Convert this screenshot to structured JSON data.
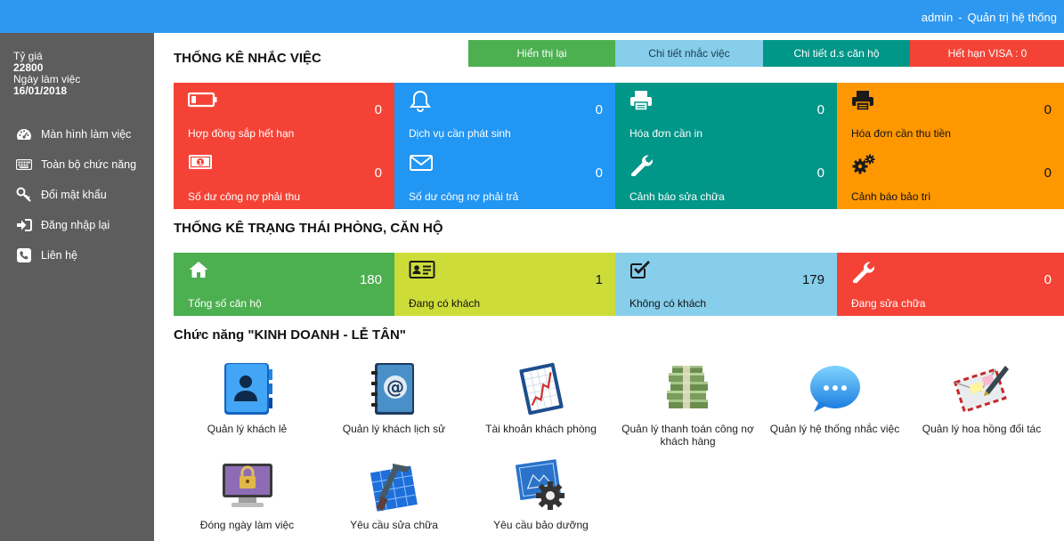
{
  "topbar": {
    "user": "admin",
    "separator": "-",
    "system": "Quản trị hệ thống"
  },
  "sidebar": {
    "rate_label": "Tỷ giá",
    "rate_value": "22800",
    "date_label": "Ngày làm việc",
    "date_value": "16/01/2018",
    "items": [
      {
        "label": "Màn hình làm việc",
        "icon": "dashboard-icon"
      },
      {
        "label": "Toàn bộ chức năng",
        "icon": "keyboard-icon"
      },
      {
        "label": "Đổi mật khẩu",
        "icon": "key-icon"
      },
      {
        "label": "Đăng nhập lại",
        "icon": "sign-in-icon"
      },
      {
        "label": "Liên hệ",
        "icon": "phone-icon"
      }
    ]
  },
  "reminders": {
    "title": "THỐNG KÊ NHẮC VIỆC",
    "actions": [
      {
        "label": "Hiển thị lại",
        "color": "#4caf50"
      },
      {
        "label": "Chi tiết nhắc việc",
        "color": "#87ceeb"
      },
      {
        "label": "Chi tiết d.s căn hộ",
        "color": "#009688"
      },
      {
        "label": "Hết hạn VISA : 0",
        "color": "#f44336"
      }
    ],
    "tiles": [
      {
        "label": "Hợp đồng sắp hết hạn",
        "value": "0",
        "color": "#f44336",
        "icon": "battery-icon"
      },
      {
        "label": "Dịch vụ cần phát sinh",
        "value": "0",
        "color": "#2196f3",
        "icon": "bell-icon"
      },
      {
        "label": "Hóa đơn cần in",
        "value": "0",
        "color": "#009688",
        "icon": "printer-icon"
      },
      {
        "label": "Hóa đơn cần thu tiền",
        "value": "0",
        "color": "#ff9800",
        "icon": "printer-icon"
      },
      {
        "label": "Số dư công nợ phải thu",
        "value": "0",
        "color": "#f44336",
        "icon": "money-icon"
      },
      {
        "label": "Số dư công nợ phải trả",
        "value": "0",
        "color": "#2196f3",
        "icon": "envelope-icon"
      },
      {
        "label": "Cảnh báo sửa chữa",
        "value": "0",
        "color": "#009688",
        "icon": "wrench-icon"
      },
      {
        "label": "Cảnh báo bảo trì",
        "value": "0",
        "color": "#ff9800",
        "icon": "gears-icon"
      }
    ]
  },
  "rooms": {
    "title": "THỐNG KÊ TRẠNG THÁI PHÒNG, CĂN HỘ",
    "tiles": [
      {
        "label": "Tổng số căn hộ",
        "value": "180",
        "color": "#4caf50",
        "icon": "home-icon"
      },
      {
        "label": "Đang có khách",
        "value": "1",
        "color": "#cddc39",
        "icon": "id-card-icon"
      },
      {
        "label": "Không có khách",
        "value": "179",
        "color": "#87ceeb",
        "icon": "checkbox-icon"
      },
      {
        "label": "Đang sửa chữa",
        "value": "0",
        "color": "#f44336",
        "icon": "wrench-icon"
      }
    ]
  },
  "business": {
    "title": "Chức năng \"KINH DOANH - LỄ TÂN\"",
    "apps": [
      {
        "label": "Quản lý khách lẻ",
        "icon": "contacts-book-icon"
      },
      {
        "label": "Quản lý khách lịch sử",
        "icon": "address-book-icon"
      },
      {
        "label": "Tài khoản khách phòng",
        "icon": "chart-report-icon"
      },
      {
        "label": "Quản lý thanh toán công nợ khách hàng",
        "icon": "money-stack-icon"
      },
      {
        "label": "Quản lý hệ thống nhắc việc",
        "icon": "chat-bubble-icon"
      },
      {
        "label": "Quản lý hoa hồng đối tác",
        "icon": "mail-pen-icon"
      },
      {
        "label": "Đóng ngày làm việc",
        "icon": "locked-monitor-icon"
      },
      {
        "label": "Yêu cầu sửa chữa",
        "icon": "blueprint-hammer-icon"
      },
      {
        "label": "Yêu cầu bảo dưỡng",
        "icon": "blueprint-gear-icon"
      }
    ]
  }
}
